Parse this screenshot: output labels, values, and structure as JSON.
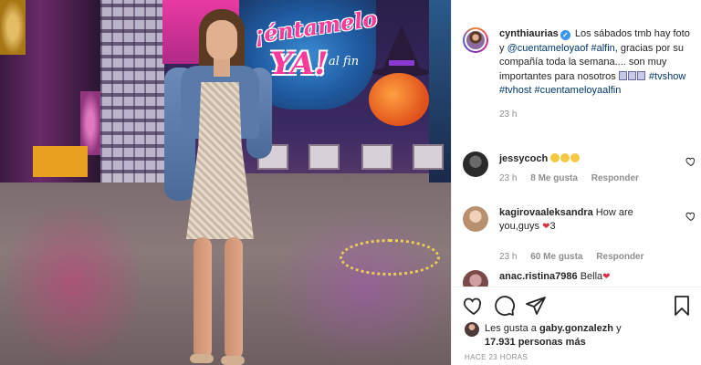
{
  "caption": {
    "username": "cynthiaurias",
    "text_1": "Los sábados tmb hay foto y ",
    "mention": "@cuentameloyaof",
    "hashtag_1": "#alfin",
    "text_2": ", gracias por su compañía toda la semana.... son muy importantes para nosotros ",
    "hashtag_2": "#tvshow",
    "hashtag_3": "#tvhost",
    "hashtag_4": "#cuentameloyaalfin",
    "time": "23 h"
  },
  "comments": [
    {
      "username": "jessycoch",
      "text": "",
      "time": "23 h",
      "likes": "8 Me gusta",
      "reply": "Responder"
    },
    {
      "username": "kagirovaaleksandra",
      "text": "How are you,guys ",
      "text_suffix": "3",
      "time": "23 h",
      "likes": "60 Me gusta",
      "reply": "Responder"
    },
    {
      "username": "anac.ristina7986",
      "text": "Bella"
    }
  ],
  "likes": {
    "prefix": "Les gusta a ",
    "user": "gaby.gonzalezh",
    "middle": " y",
    "count": "17.931 personas más"
  },
  "posted_ago": "HACE 23 HORAS",
  "photo": {
    "sign_line_1": "¡éntamelo",
    "sign_line_2": "YA!",
    "sign_line_3": "al fin"
  },
  "icons": [
    "heart-icon",
    "comment-icon",
    "share-icon",
    "bookmark-icon",
    "verified-icon"
  ],
  "colors": {
    "link": "#00376b",
    "meta": "#8e8e8e",
    "verified": "#3897f0"
  }
}
